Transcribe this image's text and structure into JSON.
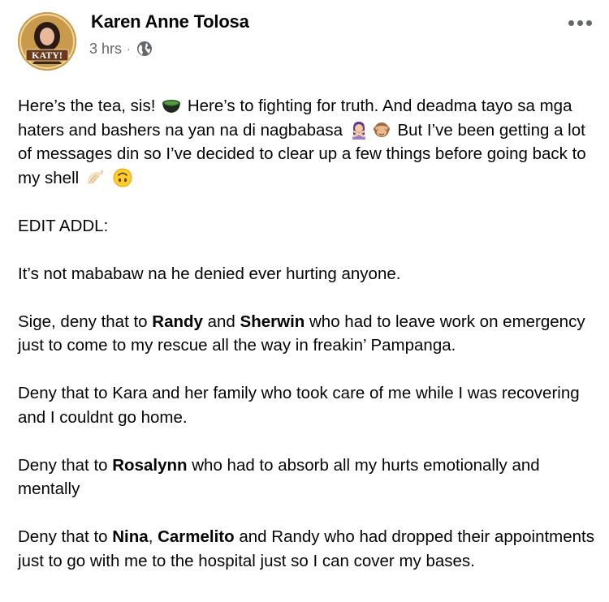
{
  "post": {
    "author": "Karen Anne Tolosa",
    "avatar": {
      "label": "KATY!",
      "colors": {
        "bg": "#c99a4c",
        "ring": "#d8b46a",
        "text": "#ffffff"
      }
    },
    "time": "3 hrs",
    "separator": "·",
    "privacy_icon": "globe-icon",
    "more_icon": "more-options-icon",
    "paragraphs": {
      "p1": {
        "a": "Here’s the tea, sis!",
        "b": "Here’s to fighting for truth. And deadma tayo sa mga haters and bashers na yan na di nagbabasa",
        "c": "But I’ve been getting a lot of messages din so I’ve decided to clear up a few things before going back to my shell",
        "emojis": [
          "tea-bowl-emoji",
          "woman-gesturing-no-emoji",
          "see-no-evil-monkey-emoji",
          "shell-emoji",
          "upside-down-face-emoji"
        ]
      },
      "p2": "EDIT ADDL:",
      "p3": "It’s not mababaw na he denied ever hurting anyone.",
      "p4": {
        "a": "Sige, deny that to",
        "b1": "Randy",
        "c": "and",
        "b2": "Sherwin",
        "d": "who had to leave work on emergency just to come to my rescue all the way in freakin’ Pampanga."
      },
      "p5": "Deny that to Kara and her family who took care of me while I was recovering and I couldnt go home.",
      "p6": {
        "a": "Deny that to",
        "b1": "Rosalynn",
        "c": "who had to absorb all my hurts emotionally and mentally"
      },
      "p7": {
        "a": "Deny that to",
        "b1": "Nina",
        "c": ",",
        "b2": "Carmelito",
        "d": "and Randy who had dropped their appointments just to go with me to the hospital just so I can cover my bases."
      }
    }
  },
  "colors": {
    "text_primary": "#050505",
    "text_secondary": "#65676b",
    "background": "#ffffff"
  }
}
